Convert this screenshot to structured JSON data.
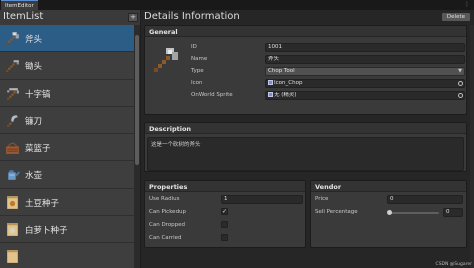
{
  "window": {
    "tab_title": "ItemEditor",
    "menu_icon": "kebab-menu-icon"
  },
  "list": {
    "title": "ItemList",
    "add_label": "+",
    "items": [
      {
        "label": "斧头",
        "icon": "axe-icon",
        "selected": true
      },
      {
        "label": "锄头",
        "icon": "hoe-icon"
      },
      {
        "label": "十字镐",
        "icon": "pickaxe-icon"
      },
      {
        "label": "镰刀",
        "icon": "sickle-icon"
      },
      {
        "label": "菜篮子",
        "icon": "basket-icon"
      },
      {
        "label": "水壶",
        "icon": "watering-can-icon"
      },
      {
        "label": "土豆种子",
        "icon": "seed-bag-icon"
      },
      {
        "label": "白萝卜种子",
        "icon": "seed-bag-icon"
      },
      {
        "label": "",
        "icon": "seed-bag-icon"
      }
    ]
  },
  "details": {
    "title": "Details Information",
    "delete_label": "Delete",
    "general": {
      "title": "General",
      "id_label": "ID",
      "id_value": "1001",
      "name_label": "Name",
      "name_value": "斧头",
      "type_label": "Type",
      "type_value": "Chop Tool",
      "icon_label": "Icon",
      "icon_value": "Icon_Chop",
      "sprite_label": "OnWorld Sprite",
      "sprite_value": "无 (精灵)"
    },
    "description": {
      "title": "Description",
      "text": "这是一个砍树的斧头"
    },
    "properties": {
      "title": "Properties",
      "use_radius_label": "Use Radius",
      "use_radius_value": "1",
      "pickup_label": "Can Pickedup",
      "pickup_checked": true,
      "dropped_label": "Can Dropped",
      "dropped_checked": false,
      "carried_label": "Can Carried",
      "carried_checked": false
    },
    "vendor": {
      "title": "Vendor",
      "price_label": "Price",
      "price_value": "0",
      "sell_label": "Sell Percentage",
      "sell_value": "0",
      "sell_fraction": 0
    }
  },
  "watermark": "CSDN @Sugarer"
}
